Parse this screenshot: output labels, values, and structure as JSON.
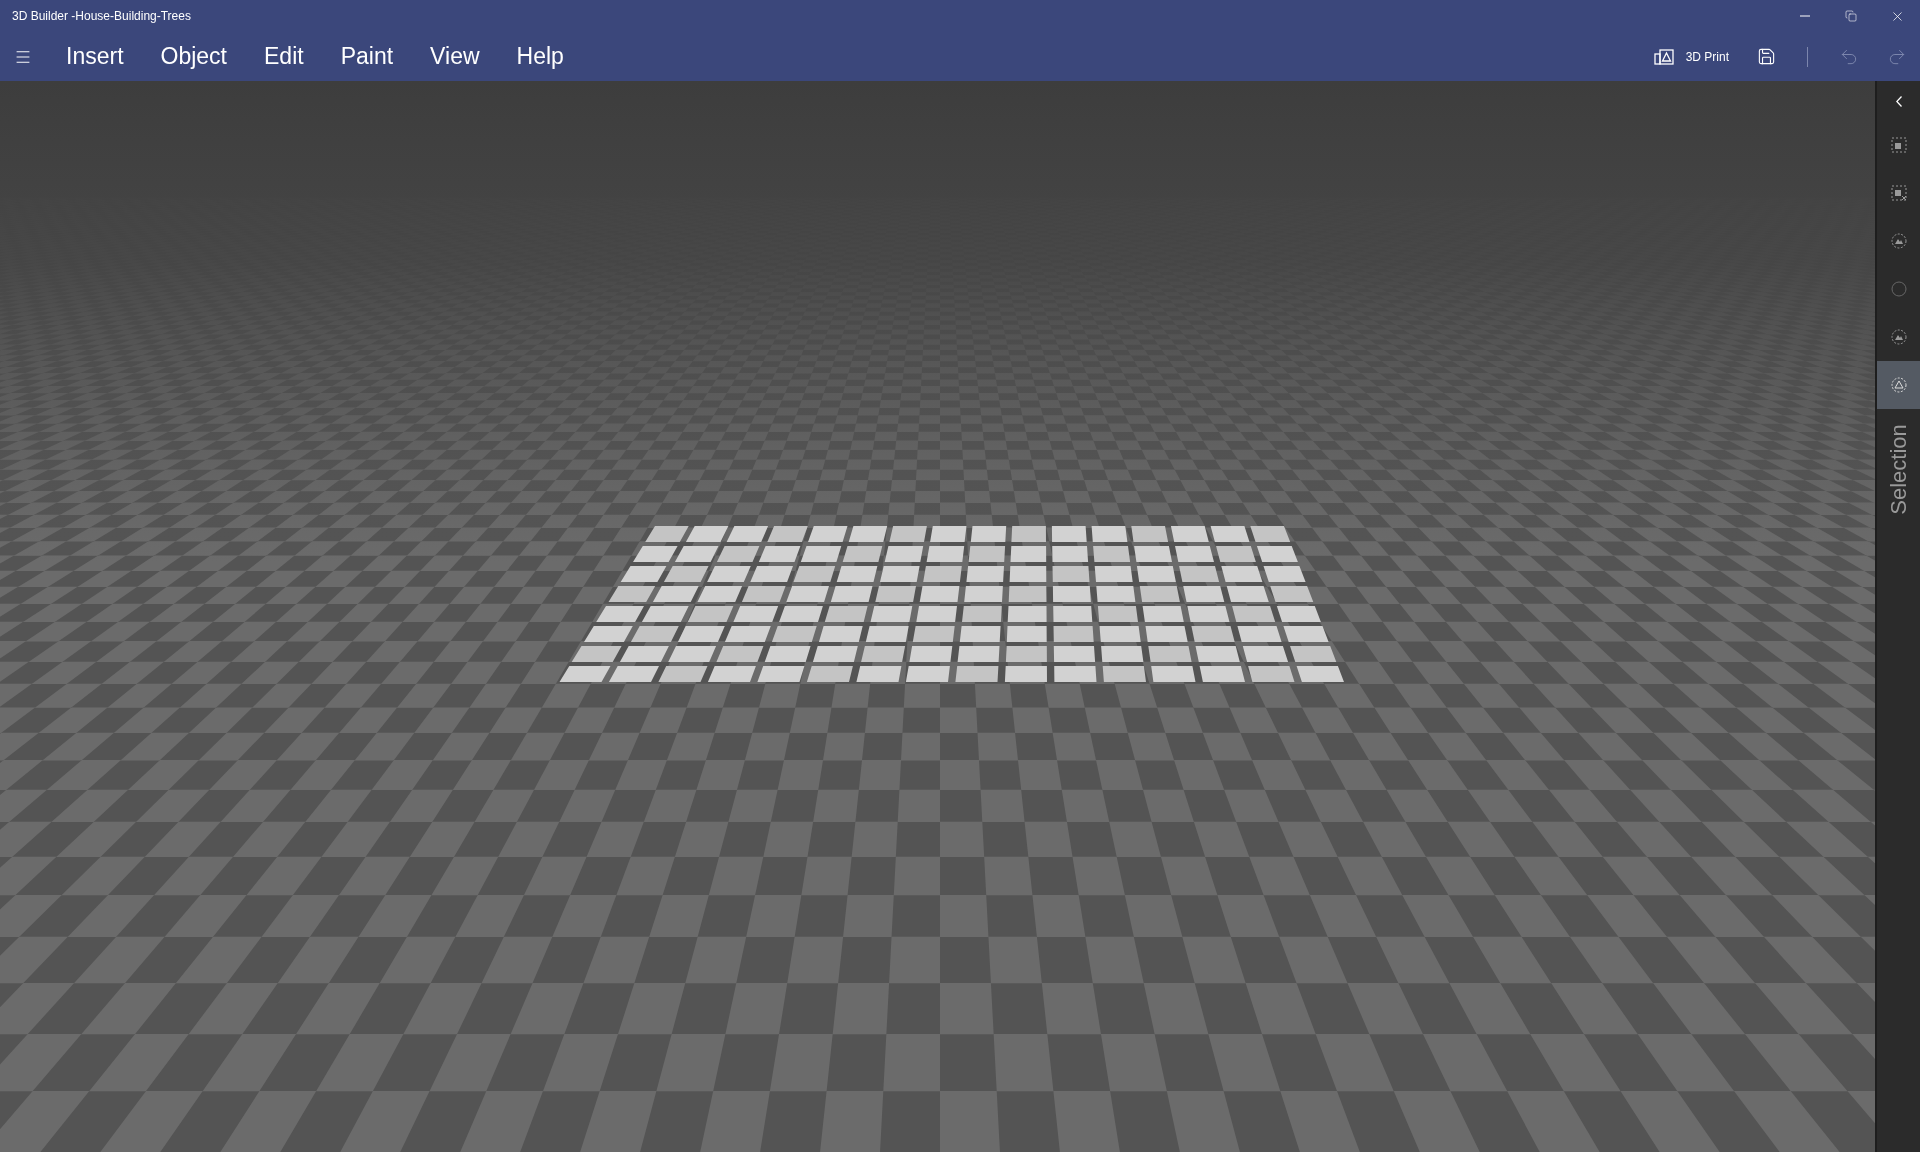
{
  "window": {
    "title": "3D Builder -House-Building-Trees"
  },
  "menu": [
    {
      "label": "Insert"
    },
    {
      "label": "Object"
    },
    {
      "label": "Edit"
    },
    {
      "label": "Paint"
    },
    {
      "label": "View"
    },
    {
      "label": "Help"
    }
  ],
  "toolbar": {
    "print_label": "3D Print"
  },
  "sidebar": {
    "tools": [
      {
        "kind": "select-all",
        "selected": false
      },
      {
        "kind": "deselect",
        "selected": false
      },
      {
        "kind": "object-mode",
        "selected": false
      },
      {
        "kind": "empty",
        "selected": false
      },
      {
        "kind": "object-mode",
        "selected": false
      },
      {
        "kind": "triangle-mode",
        "selected": true
      }
    ],
    "label": "Selection"
  }
}
